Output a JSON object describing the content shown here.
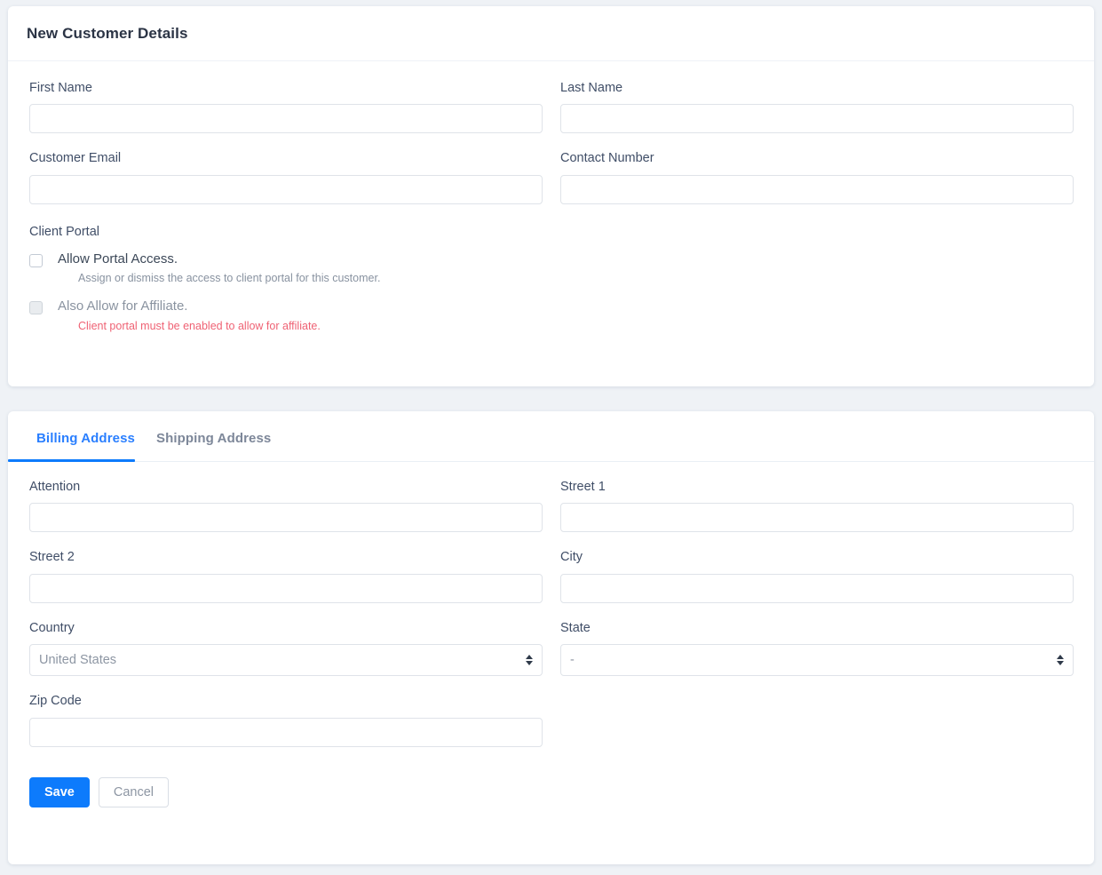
{
  "details_card": {
    "title": "New Customer Details",
    "fields": [
      {
        "label": "First Name",
        "value": "",
        "placeholder": ""
      },
      {
        "label": "Last Name",
        "value": "",
        "placeholder": ""
      },
      {
        "label": "Customer Email",
        "value": "",
        "placeholder": ""
      },
      {
        "label": "Contact Number",
        "value": "",
        "placeholder": ""
      }
    ],
    "client_portal": {
      "section_label": "Client Portal",
      "allow_portal": {
        "label": "Allow Portal Access.",
        "help": "Assign or dismiss the access to client portal for this customer.",
        "checked": false,
        "disabled": false
      },
      "allow_affiliate": {
        "label": "Also Allow for Affiliate.",
        "error": "Client portal must be enabled to allow for affiliate.",
        "checked": false,
        "disabled": true
      }
    }
  },
  "address_card": {
    "tabs": [
      {
        "label": "Billing Address",
        "active": true
      },
      {
        "label": "Shipping Address",
        "active": false
      }
    ],
    "fields": {
      "attention": {
        "label": "Attention",
        "value": "",
        "placeholder": ""
      },
      "street1": {
        "label": "Street 1",
        "value": "",
        "placeholder": ""
      },
      "street2": {
        "label": "Street 2",
        "value": "",
        "placeholder": ""
      },
      "city": {
        "label": "City",
        "value": "",
        "placeholder": ""
      },
      "country": {
        "label": "Country",
        "value": "United States"
      },
      "state": {
        "label": "State",
        "value": "-"
      },
      "zip": {
        "label": "Zip Code",
        "value": "",
        "placeholder": ""
      }
    },
    "buttons": {
      "save": "Save",
      "cancel": "Cancel"
    }
  },
  "colors": {
    "page_background": "#eff2f6",
    "card_background": "#ffffff",
    "primary": "#0d7bfc",
    "tab_active": "#2a7fff",
    "error_red": "#ef6274",
    "label": "#404e67",
    "muted": "#8892a0",
    "border": "#dfe3e9"
  }
}
